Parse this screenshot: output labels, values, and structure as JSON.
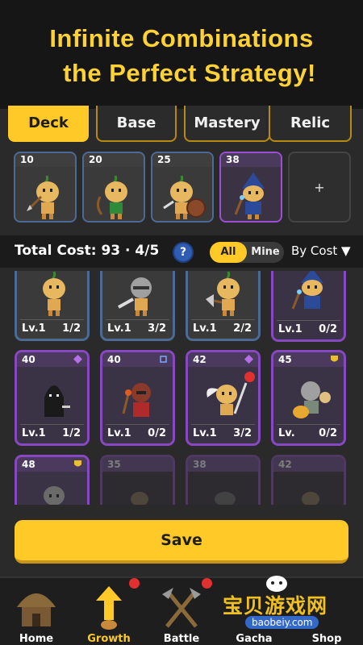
{
  "banner": {
    "line1": "Infinite Combinations",
    "line2": "the Perfect Strategy!"
  },
  "tabs": [
    {
      "label": "Deck",
      "active": true
    },
    {
      "label": "Base",
      "active": false
    },
    {
      "label": "Mastery",
      "active": false
    },
    {
      "label": "Relic",
      "active": false
    }
  ],
  "deck": [
    {
      "cost": "10",
      "border": "blue",
      "unit": "spearman"
    },
    {
      "cost": "20",
      "border": "blue",
      "unit": "archer"
    },
    {
      "cost": "25",
      "border": "blue",
      "unit": "shield-warrior"
    },
    {
      "cost": "38",
      "border": "purple",
      "unit": "wizard"
    }
  ],
  "deck_add_label": "+",
  "toolbar": {
    "total_label": "Total Cost: 93 · 4/5",
    "help_label": "?",
    "filter_all": "All",
    "filter_mine": "Mine",
    "sort_label": "By Cost ▼"
  },
  "cards": [
    {
      "cost": "",
      "lv": "Lv.1",
      "count": "1/2",
      "style": "blue",
      "unit": "onion-soldier",
      "badge": false
    },
    {
      "cost": "",
      "lv": "Lv.1",
      "count": "3/2",
      "style": "blue",
      "unit": "knight",
      "badge": true
    },
    {
      "cost": "",
      "lv": "Lv.1",
      "count": "2/2",
      "style": "blue",
      "unit": "axeman",
      "badge": true
    },
    {
      "cost": "",
      "lv": "Lv.1",
      "count": "0/2",
      "style": "purple",
      "unit": "wizard",
      "badge": false
    },
    {
      "cost": "40",
      "lv": "Lv.1",
      "count": "1/2",
      "style": "purple",
      "unit": "hooded-assassin",
      "badge": false,
      "rune": "diamond"
    },
    {
      "cost": "40",
      "lv": "Lv.1",
      "count": "0/2",
      "style": "purple",
      "unit": "torch-bearer",
      "badge": false,
      "rune": "chip"
    },
    {
      "cost": "42",
      "lv": "Lv.1",
      "count": "3/2",
      "style": "purple",
      "unit": "winged-warrior",
      "badge": true,
      "rune": "diamond"
    },
    {
      "cost": "45",
      "lv": "Lv.",
      "count": "0/2",
      "style": "purple",
      "unit": "paladin",
      "badge": false,
      "rune": "shield"
    },
    {
      "cost": "48",
      "lv": "",
      "count": "",
      "style": "purple",
      "unit": "monk",
      "badge": false,
      "rune": "shield"
    },
    {
      "cost": "35",
      "lv": "",
      "count": "",
      "style": "dim",
      "unit": "locked",
      "badge": false
    },
    {
      "cost": "38",
      "lv": "",
      "count": "",
      "style": "dim",
      "unit": "locked",
      "badge": false
    },
    {
      "cost": "42",
      "lv": "",
      "count": "",
      "style": "dim",
      "unit": "locked",
      "badge": false
    }
  ],
  "save_label": "Save",
  "nav": [
    {
      "label": "Home",
      "icon": "hut-icon",
      "active": false,
      "badge": false
    },
    {
      "label": "Growth",
      "icon": "growth-arrow-icon",
      "active": true,
      "badge": true
    },
    {
      "label": "Battle",
      "icon": "crossed-axes-icon",
      "active": false,
      "badge": true
    },
    {
      "label": "Gacha",
      "icon": "gacha-icon",
      "active": false,
      "badge": false
    },
    {
      "label": "Shop",
      "icon": "shop-icon",
      "active": false,
      "badge": false
    }
  ],
  "watermark": {
    "text": "宝贝游戏网",
    "url": "baobeiy.com"
  },
  "colors": {
    "accent": "#ffc928",
    "rare": "#9b4fd2",
    "common": "#4d6a94",
    "background": "#2a2a2a"
  }
}
